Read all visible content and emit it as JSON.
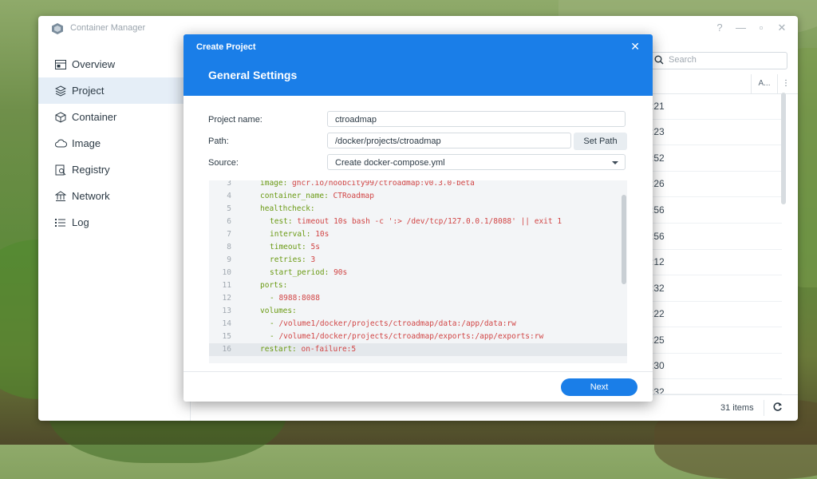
{
  "window": {
    "title": "Container Manager",
    "controls": [
      "?",
      "—",
      "▫",
      "✕"
    ]
  },
  "sidebar": {
    "items": [
      {
        "label": "Overview",
        "icon": "overview-icon",
        "active": false
      },
      {
        "label": "Project",
        "icon": "project-icon",
        "active": true
      },
      {
        "label": "Container",
        "icon": "container-icon",
        "active": false
      },
      {
        "label": "Image",
        "icon": "cloud-icon",
        "active": false
      },
      {
        "label": "Registry",
        "icon": "registry-icon",
        "active": false
      },
      {
        "label": "Network",
        "icon": "network-icon",
        "active": false
      },
      {
        "label": "Log",
        "icon": "log-icon",
        "active": false
      }
    ]
  },
  "search": {
    "placeholder": "Search"
  },
  "list": {
    "column_a": "A...",
    "column_more": "⋮",
    "rows": [
      ":21",
      ":23",
      ":52",
      ":26",
      ":56",
      ":56",
      ":12",
      ":32",
      ":22",
      ":25",
      ":30",
      ":32"
    ],
    "items_count": "31 items"
  },
  "modal": {
    "title": "Create Project",
    "section": "General Settings",
    "project_name_label": "Project name:",
    "project_name_value": "ctroadmap",
    "path_label": "Path:",
    "path_value": "/docker/projects/ctroadmap",
    "set_path_label": "Set Path",
    "source_label": "Source:",
    "source_value": "Create docker-compose.yml",
    "next_label": "Next"
  },
  "editor": {
    "lines": [
      {
        "n": "3",
        "key": "image:",
        "val": " ghcr.io/noobcity99/ctroadmap:v0.3.0-beta",
        "indent": 0
      },
      {
        "n": "4",
        "key": "container_name:",
        "val": " CTRoadmap",
        "indent": 0
      },
      {
        "n": "5",
        "key": "healthcheck:",
        "val": "",
        "indent": 0
      },
      {
        "n": "6",
        "key": "test:",
        "val": " timeout 10s bash -c ':> /dev/tcp/127.0.0.1/8088' || exit 1",
        "indent": 1
      },
      {
        "n": "7",
        "key": "interval:",
        "val": " 10s",
        "indent": 1
      },
      {
        "n": "8",
        "key": "timeout:",
        "val": " 5s",
        "indent": 1
      },
      {
        "n": "9",
        "key": "retries:",
        "val": " 3",
        "indent": 1
      },
      {
        "n": "10",
        "key": "start_period:",
        "val": " 90s",
        "indent": 1
      },
      {
        "n": "11",
        "key": "ports:",
        "val": "",
        "indent": 0
      },
      {
        "n": "12",
        "key": "- ",
        "val": "8988:8088",
        "indent": 1
      },
      {
        "n": "13",
        "key": "volumes:",
        "val": "",
        "indent": 0
      },
      {
        "n": "14",
        "key": "- ",
        "val": "/volume1/docker/projects/ctroadmap/data:/app/data:rw",
        "indent": 1
      },
      {
        "n": "15",
        "key": "- ",
        "val": "/volume1/docker/projects/ctroadmap/exports:/app/exports:rw",
        "indent": 1
      },
      {
        "n": "16",
        "key": "restart:",
        "val": " on-failure:5",
        "indent": 0,
        "highlight": true
      }
    ]
  },
  "colors": {
    "accent": "#1a7ee8",
    "yaml_key": "#6a9a13",
    "yaml_value": "#d14545",
    "sidebar_active": "#e5eef7"
  }
}
